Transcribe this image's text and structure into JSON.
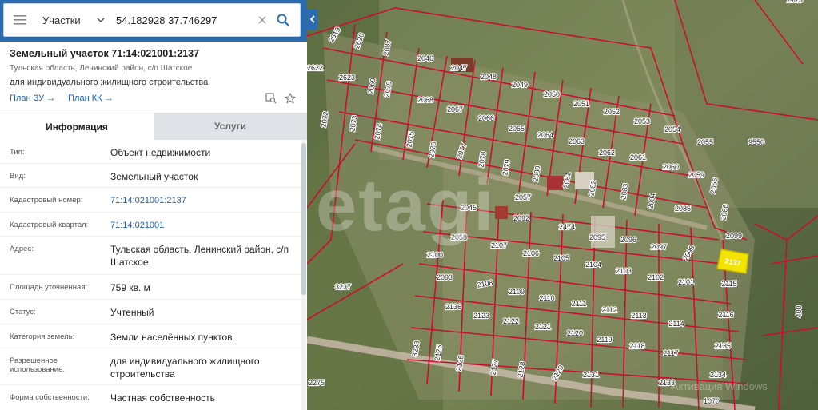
{
  "search": {
    "type_label": "Участки",
    "query": "54.182928 37.746297"
  },
  "parcel": {
    "title": "Земельный участок 71:14:021001:2137",
    "location": "Тульская область, Ленинский район, с/п Шатское",
    "purpose": "для индивидуального жилищного строительства",
    "plan_zu": "План ЗУ →",
    "plan_kk": "План КК →"
  },
  "tabs": {
    "info": "Информация",
    "services": "Услуги"
  },
  "info": {
    "type_label": "Тип:",
    "type_value": "Объект недвижимости",
    "kind_label": "Вид:",
    "kind_value": "Земельный участок",
    "cadnum_label": "Кадастровый номер:",
    "cadnum_value": "71:14:021001:2137",
    "quarter_label": "Кадастровый квартал:",
    "quarter_value": "71:14:021001",
    "address_label": "Адрес:",
    "address_value": "Тульская область, Ленинский район, с/п Шатское",
    "area_label": "Площадь уточненная:",
    "area_value": "759 кв. м",
    "status_label": "Статус:",
    "status_value": "Учтенный",
    "category_label": "Категория земель:",
    "category_value": "Земли населённых пунктов",
    "permitted_label": "Разрешенное использование:",
    "permitted_value": "для индивидуального жилищного строительства",
    "ownership_label": "Форма собственности:",
    "ownership_value": "Частная собственность"
  },
  "map": {
    "watermark": "etagi",
    "windows_watermark": "Активация Windows",
    "selected_parcel": "2137",
    "parcel_labels": [
      "2619",
      "2620",
      "2087",
      "2046",
      "2622",
      "2623",
      "2069",
      "2047",
      "2048",
      "2049",
      "2050",
      "2051",
      "2052",
      "2053",
      "2054",
      "2055",
      "2072",
      "2073",
      "2070",
      "2068",
      "2067",
      "2066",
      "2065",
      "2064",
      "2063",
      "2062",
      "2061",
      "2060",
      "2059",
      "2056",
      "2074",
      "2075",
      "2076",
      "2077",
      "2078",
      "2079",
      "2080",
      "2081",
      "2082",
      "2083",
      "2084",
      "2085",
      "2086",
      "2057",
      "2045",
      "2092",
      "2474",
      "2095",
      "2096",
      "2097",
      "2098",
      "2099",
      "2058",
      "2107",
      "2106",
      "2105",
      "2104",
      "2103",
      "2102",
      "2101",
      "2100",
      "2093",
      "2108",
      "2109",
      "2110",
      "2111",
      "2112",
      "2113",
      "2114",
      "2115",
      "2136",
      "2123",
      "2122",
      "2121",
      "2120",
      "2119",
      "2118",
      "2117",
      "2116",
      "2135",
      "2134",
      "2133",
      "2131",
      "2129",
      "2128",
      "2127",
      "2126",
      "2125",
      "3238",
      "3237",
      "9550",
      "2723",
      "1070",
      "2275",
      "400",
      "210"
    ],
    "colors": {
      "boundary": "#c8102e",
      "selected": "#f2e400",
      "accent": "#2b6cb0"
    }
  }
}
